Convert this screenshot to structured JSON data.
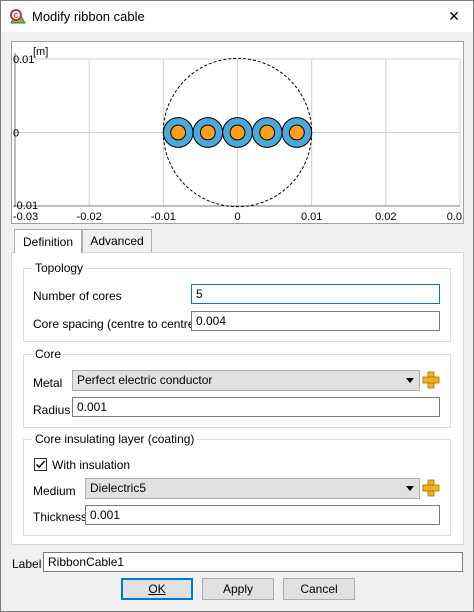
{
  "window": {
    "title": "Modify ribbon cable",
    "close_glyph": "✕"
  },
  "plot": {
    "unit_label": "[m]",
    "x_ticks": [
      "-0.03",
      "-0.02",
      "-0.01",
      "0",
      "0.01",
      "0.02",
      "0.0"
    ],
    "y_ticks": [
      "0.01",
      "0",
      "-0.01"
    ]
  },
  "chart_data": {
    "type": "scatter",
    "title": "",
    "xlabel": "",
    "ylabel": "[m]",
    "xlim": [
      -0.03,
      0.03
    ],
    "ylim": [
      -0.01,
      0.01
    ],
    "grid": true,
    "cores": {
      "x": [
        -0.008,
        -0.004,
        0.0,
        0.004,
        0.008
      ],
      "y": [
        0,
        0,
        0,
        0,
        0
      ],
      "conductor_radius": 0.001,
      "insulation_radius": 0.002
    },
    "bounding_circle_radius": 0.01,
    "colors": {
      "conductor": "#ff9e1a",
      "insulation": "#4aa9d8",
      "outline": "#000000"
    }
  },
  "tabs": [
    {
      "label": "Definition",
      "active": true
    },
    {
      "label": "Advanced",
      "active": false
    }
  ],
  "topology": {
    "title": "Topology",
    "num_cores_label": "Number of cores",
    "num_cores_value": "5",
    "spacing_label": "Core spacing (centre to centre)",
    "spacing_value": "0.004"
  },
  "core": {
    "title": "Core",
    "metal_label": "Metal",
    "metal_value": "Perfect electric conductor",
    "radius_label": "Radius",
    "radius_value": "0.001"
  },
  "insulation": {
    "title": "Core insulating layer (coating)",
    "with_insulation_label": "With insulation",
    "with_insulation_checked": true,
    "medium_label": "Medium",
    "medium_value": "Dielectric5",
    "thickness_label": "Thickness",
    "thickness_value": "0.001"
  },
  "footer": {
    "label_label": "Label",
    "label_value": "RibbonCable1",
    "ok_label": "OK",
    "apply_label": "Apply",
    "cancel_label": "Cancel"
  },
  "icons": {
    "app": "cable-app-icon",
    "add": "add-media-icon",
    "check": "checkmark-icon"
  }
}
